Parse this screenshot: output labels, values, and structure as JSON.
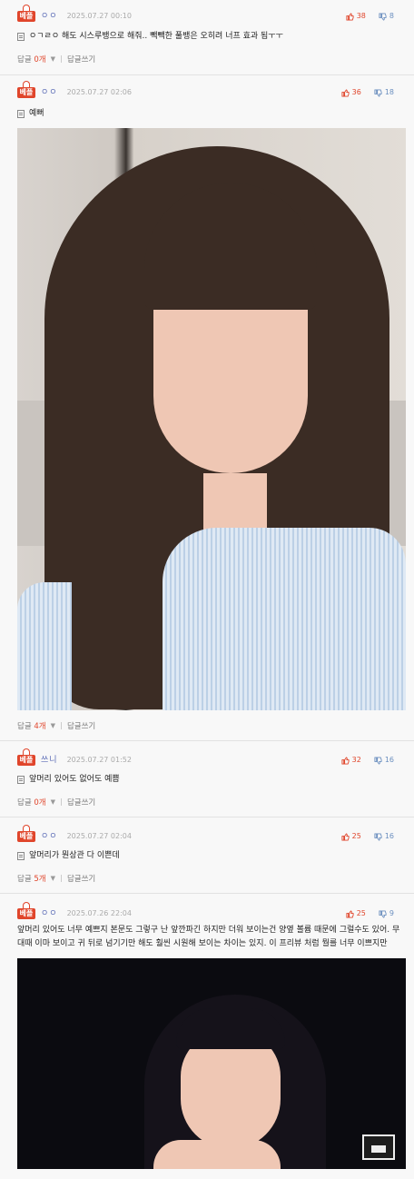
{
  "badge_label": "베플",
  "comments": [
    {
      "nick": "ㅇㅇ",
      "date": "2025.07.27 00:10",
      "up": "38",
      "down": "8",
      "text": "ㅇㄱㄹㅇ 해도 시스루뱅으로 해줘.. 빽빽한 풀뱅은 오히려 너프 효과 됨ㅜㅜ",
      "reply_label": "답글",
      "reply_count": "0개",
      "write_reply": "답글쓰기"
    },
    {
      "nick": "ㅇㅇ",
      "date": "2025.07.27 02:06",
      "up": "36",
      "down": "18",
      "text": "예뻐",
      "reply_label": "답글",
      "reply_count": "4개",
      "write_reply": "답글쓰기"
    },
    {
      "nick": "쓰니",
      "date": "2025.07.27 01:52",
      "up": "32",
      "down": "16",
      "text": "앞머리 있어도 없어도 예쁨",
      "reply_label": "답글",
      "reply_count": "0개",
      "write_reply": "답글쓰기"
    },
    {
      "nick": "ㅇㅇ",
      "date": "2025.07.27 02:04",
      "up": "25",
      "down": "16",
      "text": "앞머리가 뭔상관 다 이쁜데",
      "reply_label": "답글",
      "reply_count": "5개",
      "write_reply": "답글쓰기"
    },
    {
      "nick": "ㅇㅇ",
      "date": "2025.07.26 22:04",
      "up": "25",
      "down": "9",
      "text": "앞머리 있어도 너무 예쁘지 본문도 그렇구 난 앞깐파긴 하지만 더워 보이는건 양옆 볼륨 때문에 그럴수도 있어. 무대때 이마 보이고 귀 뒤로 넘기기만 해도 훨씬 시원해 보이는 차이는 있지. 이 프리뷰 처럼 뭘를 너무 이쁘지만"
    }
  ],
  "colors": {
    "accent_red": "#e0452b",
    "nick_blue": "#5a6bb6",
    "down_blue": "#6b8fbf"
  },
  "icons": {
    "badge": "best-badge-icon",
    "up": "thumbs-up-icon",
    "down": "thumbs-down-icon",
    "doc": "document-icon",
    "caret": "caret-down-icon"
  }
}
